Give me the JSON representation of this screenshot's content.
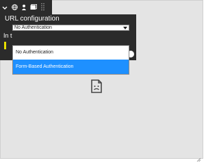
{
  "toolbar": {
    "icons": [
      "chevron-down-icon",
      "globe-icon",
      "user-icon",
      "image-icon",
      "drag-grip-icon"
    ]
  },
  "popup": {
    "title": "URL configuration",
    "select_value": "No Authentication",
    "side_label": "In t",
    "options": [
      "No Authentication",
      "Form-Based Authentication"
    ],
    "selected_index": 1
  },
  "content": {
    "placeholder_icon": "sad-page-icon"
  },
  "colors": {
    "toolbar_bg": "#2b2b2b",
    "selection": "#1e90ff",
    "warning": "#e8e000",
    "canvas_bg": "#e4e4e4"
  }
}
